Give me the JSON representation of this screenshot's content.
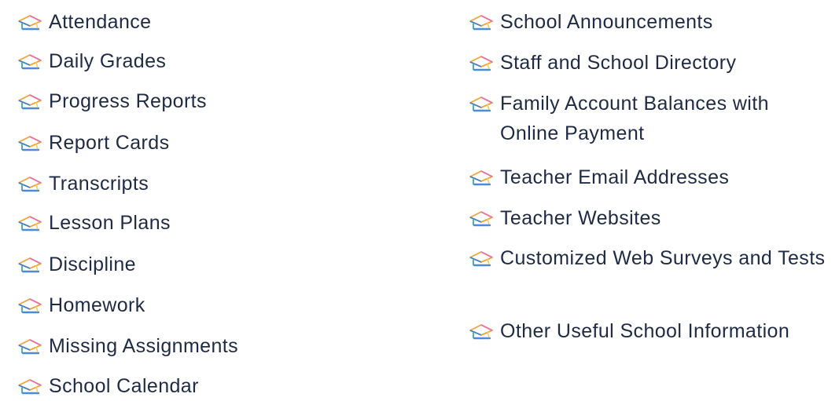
{
  "left_list": {
    "items": [
      {
        "label": "Attendance",
        "icon": "graduation-cap-icon"
      },
      {
        "label": "Daily Grades",
        "icon": "graduation-cap-icon"
      },
      {
        "label": "Progress Reports",
        "icon": "graduation-cap-icon"
      },
      {
        "label": "Report Cards",
        "icon": "graduation-cap-icon"
      },
      {
        "label": "Transcripts",
        "icon": "graduation-cap-icon"
      },
      {
        "label": "Lesson Plans",
        "icon": "graduation-cap-icon"
      },
      {
        "label": "Discipline",
        "icon": "graduation-cap-icon"
      },
      {
        "label": "Homework",
        "icon": "graduation-cap-icon"
      },
      {
        "label": "Missing Assignments",
        "icon": "graduation-cap-icon"
      },
      {
        "label": "School Calendar",
        "icon": "graduation-cap-icon"
      }
    ]
  },
  "right_list": {
    "items": [
      {
        "label": "School Announcements",
        "icon": "graduation-cap-icon"
      },
      {
        "label": "Staff and School Directory",
        "icon": "graduation-cap-icon"
      },
      {
        "label": "Family Account Balances with Online Payment",
        "icon": "graduation-cap-icon"
      },
      {
        "label": "Teacher Email Addresses",
        "icon": "graduation-cap-icon"
      },
      {
        "label": "Teacher Websites",
        "icon": "graduation-cap-icon"
      },
      {
        "label": "Customized Web Surveys and Tests",
        "icon": "graduation-cap-icon"
      },
      {
        "label": "Other Useful School Information",
        "icon": "graduation-cap-icon"
      }
    ]
  },
  "colors": {
    "text": "#1f2a44",
    "cap_orange": "#f2a33a",
    "cap_pink": "#e86aa8",
    "cap_blue": "#3b7fd1",
    "cap_teal": "#4fb3a9",
    "cap_yellow": "#f3d24a"
  }
}
